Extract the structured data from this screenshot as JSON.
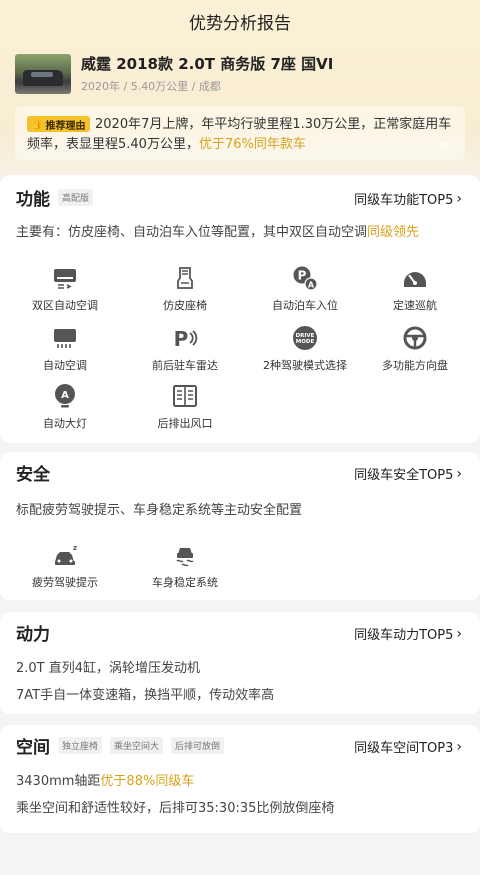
{
  "header": {
    "title": "优势分析报告"
  },
  "car": {
    "title": "威霆 2018款 2.0T 商务版 7座 国VI",
    "subtitle": "2020年 / 5.40万公里 / 成都"
  },
  "reason": {
    "badge": "推荐理由",
    "text_main": "2020年7月上牌，年平均行驶里程1.30万公里，正常家庭用车频率，表显里程5.40万公里，",
    "text_highlight": "优于76%同年款车"
  },
  "sections": {
    "function": {
      "title": "功能",
      "tag": "高配版",
      "link": "同级车功能TOP5",
      "desc_main": "主要有：仿皮座椅、自动泊车入位等配置，其中双区自动空调",
      "desc_highlight": "同级领先",
      "features": [
        {
          "label": "双区自动空调",
          "icon": "dual-zone-ac-icon"
        },
        {
          "label": "仿皮座椅",
          "icon": "leather-seat-icon"
        },
        {
          "label": "自动泊车入位",
          "icon": "auto-parking-icon"
        },
        {
          "label": "定速巡航",
          "icon": "cruise-control-icon"
        },
        {
          "label": "自动空调",
          "icon": "auto-ac-icon"
        },
        {
          "label": "前后驻车雷达",
          "icon": "parking-radar-icon"
        },
        {
          "label": "2种驾驶模式选择",
          "icon": "drive-mode-icon",
          "icon_text": "DRIVE MODE"
        },
        {
          "label": "多功能方向盘",
          "icon": "steering-wheel-icon"
        },
        {
          "label": "自动大灯",
          "icon": "auto-headlight-icon"
        },
        {
          "label": "后排出风口",
          "icon": "rear-vent-icon"
        }
      ]
    },
    "safety": {
      "title": "安全",
      "link": "同级车安全TOP5",
      "desc": "标配疲劳驾驶提示、车身稳定系统等主动安全配置",
      "features": [
        {
          "label": "疲劳驾驶提示",
          "icon": "fatigue-alert-icon"
        },
        {
          "label": "车身稳定系统",
          "icon": "stability-control-icon"
        }
      ]
    },
    "power": {
      "title": "动力",
      "link": "同级车动力TOP5",
      "lines": [
        "2.0T 直列4缸，涡轮增压发动机",
        "7AT手自一体变速箱，换挡平顺，传动效率高"
      ]
    },
    "space": {
      "title": "空间",
      "tags": [
        "独立座椅",
        "乘坐空间大",
        "后排可放倒"
      ],
      "link": "同级车空间TOP3",
      "line1_main": "3430mm轴距",
      "line1_highlight": "优于88%同级车",
      "line2": "乘坐空间和舒适性较好，后排可35:30:35比例放倒座椅"
    }
  },
  "colors": {
    "accent": "#d9a21b",
    "badge": "#f6c22c",
    "top_gradient": "#fbf1d6"
  }
}
